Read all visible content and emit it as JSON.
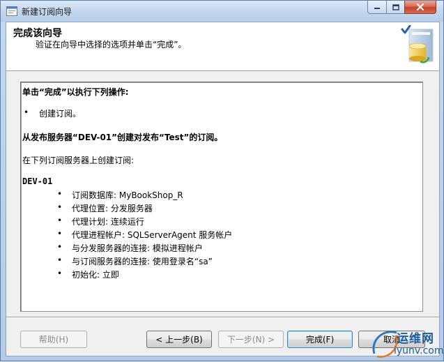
{
  "window": {
    "title": "新建订阅向导"
  },
  "header": {
    "title": "完成该向导",
    "subtitle": "验证在向导中选择的选项并单击“完成”。"
  },
  "report": {
    "heading": "单击“完成”以执行下列操作:",
    "action_item": "创建订阅。",
    "publication_line": "从发布服务器“DEV-01”创建对发布“Test”的订阅。",
    "subscriber_intro": "在下列订阅服务器上创建订阅:",
    "server": "DEV-01",
    "details": [
      "订阅数据库: MyBookShop_R",
      "代理位置: 分发服务器",
      "代理计划: 连续运行",
      "代理进程帐户: SQLServerAgent 服务帐户",
      "与分发服务器的连接: 模拟进程帐户",
      "与订阅服务器的连接: 使用登录名“sa”",
      "初始化: 立即"
    ],
    "bullet": "•"
  },
  "buttons": {
    "help": "帮助(H)",
    "back": "< 上一步(B)",
    "next": "下一步(N) >",
    "finish": "完成(F)",
    "cancel": "取消"
  },
  "watermark": {
    "top": "运维网",
    "bottom": "iyunv.com"
  },
  "colors": {
    "titlebar": "#c3d7ee",
    "close": "#c1432a",
    "watermark": "#1b5ea0"
  }
}
